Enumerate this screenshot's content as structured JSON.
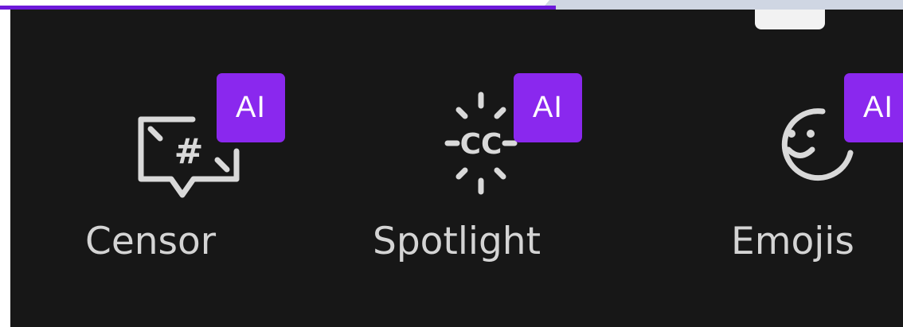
{
  "tools": [
    {
      "label": "Censor",
      "badge": "AI",
      "icon": "hashtag-chat-icon"
    },
    {
      "label": "Spotlight",
      "badge": "AI",
      "icon": "cc-sparkle-icon"
    },
    {
      "label": "Emojis",
      "badge": "AI",
      "icon": "smiley-icon"
    }
  ],
  "colors": {
    "panel_background": "#171717",
    "accent_purple": "#8a28ee",
    "top_line_purple": "#6d19d9",
    "label_text": "#d4d4d4",
    "icon_stroke": "#d9d9d9"
  }
}
